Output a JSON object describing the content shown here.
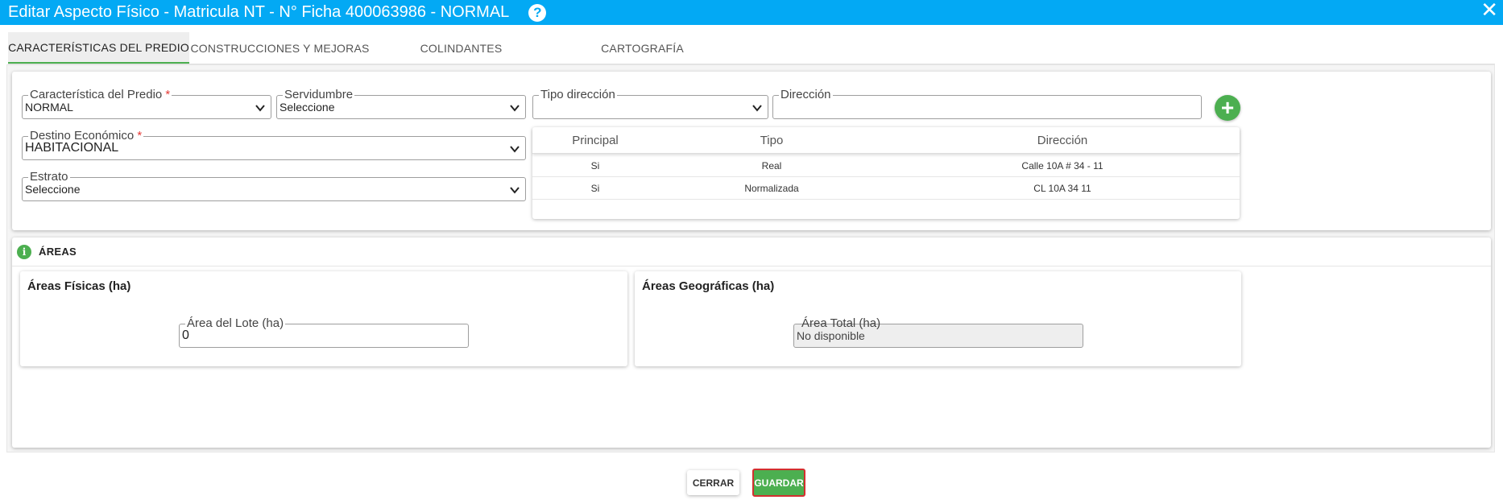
{
  "window": {
    "title": "Editar Aspecto Físico - Matricula NT - N° Ficha 400063986 - NORMAL",
    "help_symbol": "?",
    "close_symbol": "✕"
  },
  "tabs": [
    {
      "label": "CARACTERÍSTICAS DEL PREDIO",
      "active": true
    },
    {
      "label": "CONSTRUCCIONES Y MEJORAS",
      "active": false
    },
    {
      "label": "COLINDANTES",
      "active": false
    },
    {
      "label": "CARTOGRAFÍA",
      "active": false
    }
  ],
  "predio": {
    "caracteristica": {
      "label": "Característica del Predio",
      "required": "*",
      "value": "NORMAL"
    },
    "servidumbre": {
      "label": "Servidumbre",
      "value": "Seleccione"
    },
    "destino": {
      "label": "Destino Económico",
      "required": "*",
      "value": "HABITACIONAL"
    },
    "estrato": {
      "label": "Estrato",
      "value": "Seleccione"
    },
    "tipo_direccion": {
      "label": "Tipo dirección",
      "value": ""
    },
    "direccion": {
      "label": "Dirección",
      "value": ""
    },
    "add_symbol": "+"
  },
  "direcciones": {
    "columns": [
      "Principal",
      "Tipo",
      "Dirección"
    ],
    "rows": [
      {
        "principal": "Si",
        "tipo": "Real",
        "direccion": "Calle 10A # 34 - 11"
      },
      {
        "principal": "Si",
        "tipo": "Normalizada",
        "direccion": "CL 10A 34 11"
      }
    ]
  },
  "areas": {
    "title": "ÁREAS",
    "info_symbol": "i",
    "fisicas": {
      "title": "Áreas Físicas (ha)",
      "lote": {
        "label": "Área del Lote (ha)",
        "value": "0"
      }
    },
    "geograficas": {
      "title": "Áreas Geográficas (ha)",
      "total": {
        "label": "Área Total (ha)",
        "value": "No disponible"
      }
    }
  },
  "actions": {
    "cerrar": "CERRAR",
    "guardar": "GUARDAR"
  },
  "colors": {
    "header": "#03a9f4",
    "accent": "#4caf50",
    "highlight_border": "#d32f2f"
  }
}
